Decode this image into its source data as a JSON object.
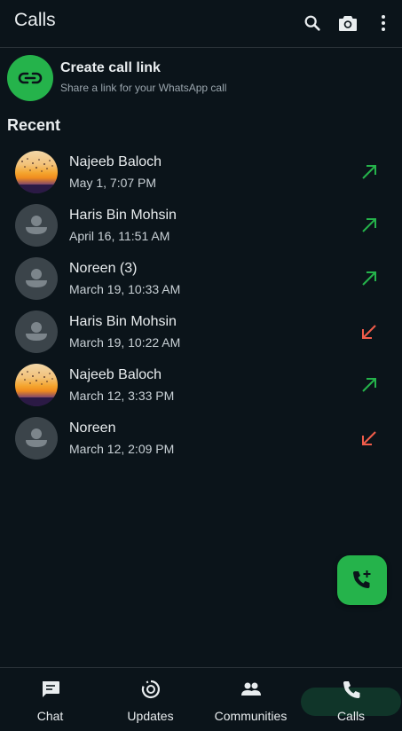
{
  "header": {
    "title": "Calls",
    "icons": [
      "search-icon",
      "camera-icon",
      "more-vert-icon"
    ]
  },
  "create_link": {
    "title": "Create call link",
    "subtitle": "Share a link for your WhatsApp call",
    "icon": "link-icon"
  },
  "recent": {
    "heading": "Recent",
    "calls": [
      {
        "name": "Najeeb Baloch",
        "time": "May 1, 7:07 PM",
        "direction": "outgoing",
        "avatar": "photo"
      },
      {
        "name": "Haris Bin Mohsin",
        "time": "April 16, 11:51 AM",
        "direction": "outgoing",
        "avatar": "default"
      },
      {
        "name": "Noreen (3)",
        "time": "March 19, 10:33 AM",
        "direction": "outgoing",
        "avatar": "default"
      },
      {
        "name": "Haris Bin Mohsin",
        "time": "March 19, 10:22 AM",
        "direction": "missed",
        "avatar": "default"
      },
      {
        "name": "Najeeb Baloch",
        "time": "March 12, 3:33 PM",
        "direction": "outgoing",
        "avatar": "photo"
      },
      {
        "name": "Noreen",
        "time": "March 12, 2:09 PM",
        "direction": "missed",
        "avatar": "default"
      }
    ]
  },
  "fab": {
    "icon": "add-call-icon"
  },
  "nav": {
    "chat": "Chat",
    "updates": "Updates",
    "communities": "Communities",
    "calls": "Calls",
    "active": "calls"
  },
  "colors": {
    "background": "#0b141a",
    "accent": "#25b34b",
    "outgoing": "#25b34b",
    "missed": "#f15c4a",
    "active_pill": "#103529"
  }
}
